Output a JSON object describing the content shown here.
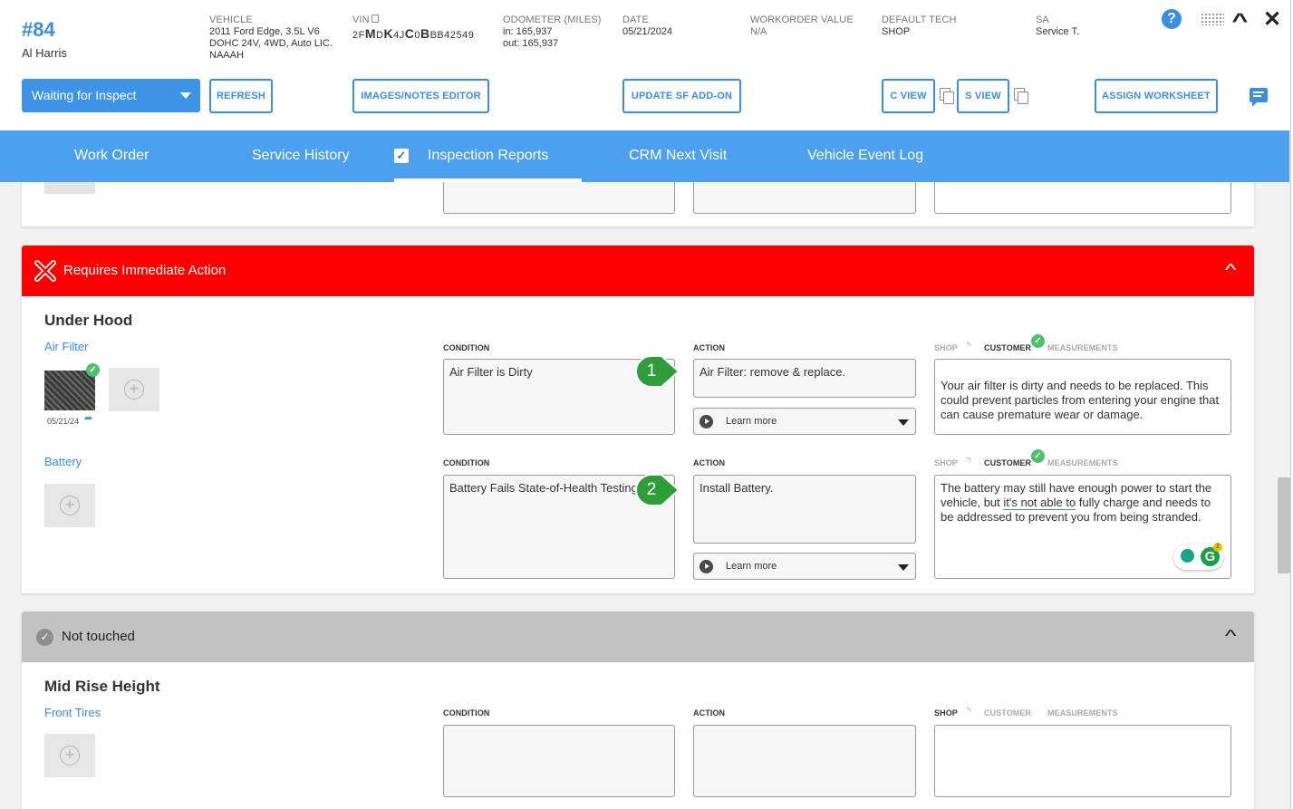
{
  "workorder": {
    "number": "#84",
    "customer": "Al Harris"
  },
  "meta": {
    "vehicle_label": "VEHICLE",
    "vehicle_line1": "2011 Ford Edge, 3.5L V6",
    "vehicle_line2": "DOHC 24V, 4WD, Auto LIC.",
    "vehicle_line3": "NAAAH",
    "vin_label": "VIN",
    "vin_parts": [
      "2F",
      "M",
      "D",
      "K",
      "4J",
      "C",
      "0",
      "B",
      "BB42549"
    ],
    "odometer_label": "ODOMETER (MILES)",
    "odometer_in": "in: 165,937",
    "odometer_out": "out: 165,937",
    "date_label": "DATE",
    "date_value": "05/21/2024",
    "wo_value_label": "WORKORDER VALUE",
    "wo_value": "N/A",
    "tech_label": "DEFAULT TECH",
    "tech_value": "SHOP",
    "sa_label": "SA",
    "sa_value": "Service T."
  },
  "toolbar": {
    "status": "Waiting for Inspect",
    "refresh": "REFRESH",
    "images_notes": "IMAGES/NOTES EDITOR",
    "update_sf": "UPDATE SF ADD-ON",
    "c_view": "C VIEW",
    "s_view": "S VIEW",
    "assign_worksheet": "ASSIGN WORKSHEET",
    "help": "?"
  },
  "tabs": [
    {
      "label": "Work Order"
    },
    {
      "label": "Service History"
    },
    {
      "label": "Inspection Reports"
    },
    {
      "label": "CRM Next Visit"
    },
    {
      "label": "Vehicle Event Log"
    }
  ],
  "sections": {
    "immediate": {
      "title": "Requires Immediate Action",
      "group": "Under Hood",
      "items": [
        {
          "name": "Air Filter",
          "photo_date": "05/21/24",
          "condition_label": "CONDITION",
          "condition": "Air Filter is Dirty",
          "action_label": "ACTION",
          "action": "Air Filter: remove & replace.",
          "learn_more": "Learn more",
          "shop_label": "SHOP",
          "customer_label": "CUSTOMER",
          "measurements_label": "MEASUREMENTS",
          "customer_text": "Your air filter is dirty and needs to be replaced. This could prevent particles from entering your engine that can cause premature wear or damage.",
          "step": "1"
        },
        {
          "name": "Battery",
          "condition_label": "CONDITION",
          "condition": "Battery Fails State-of-Health Testing",
          "action_label": "ACTION",
          "action": "Install Battery.",
          "learn_more": "Learn more",
          "shop_label": "SHOP",
          "customer_label": "CUSTOMER",
          "measurements_label": "MEASUREMENTS",
          "customer_text_a": "The battery may still have enough power to start the vehicle, but ",
          "customer_text_u": "it's not able to",
          "customer_text_b": " fully charge and needs to be addressed to prevent you from being stranded.",
          "step": "2",
          "grammarly_count": "2"
        }
      ]
    },
    "not_touched": {
      "title": "Not touched",
      "group": "Mid Rise Height",
      "item": "Front Tires",
      "condition_label": "CONDITION",
      "action_label": "ACTION",
      "shop_label": "SHOP",
      "customer_label": "CUSTOMER",
      "measurements_label": "MEASUREMENTS"
    }
  },
  "colors": {
    "accent": "#3b8de0",
    "tabbar": "#4ca0ee",
    "danger": "#ff0000",
    "neutral_header": "#c2c2c2",
    "step_badge": "#2e9e3a"
  },
  "icons": {
    "help": "help-icon",
    "apps": "grid-icon",
    "collapse": "chevron-up-icon",
    "close": "close-icon",
    "chat": "chat-icon",
    "copy": "copy-icon"
  }
}
